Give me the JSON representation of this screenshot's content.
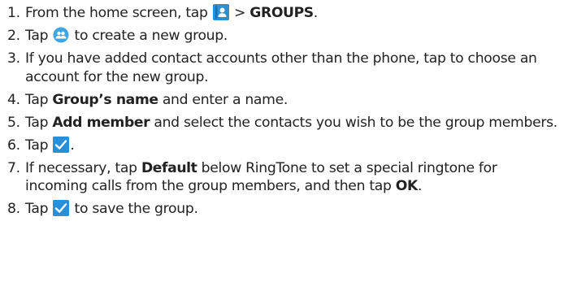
{
  "colors": {
    "text": "#222222",
    "icon_blue": "#2b8fd6",
    "icon_light_blue": "#3ea6e6"
  },
  "icons": {
    "contacts": "contacts-app-icon",
    "add_group": "add-group-icon",
    "check": "check-icon"
  },
  "steps": [
    {
      "num": "1.",
      "pre": "From the home screen, tap",
      "mid": ">",
      "bold": "GROUPS",
      "post": "."
    },
    {
      "num": "2.",
      "pre": "Tap",
      "post": "to create a new group."
    },
    {
      "num": "3.",
      "text": "If you have added contact accounts other than the phone, tap to choose an account for the new group."
    },
    {
      "num": "4.",
      "pre": "Tap",
      "bold": "Group’s name",
      "post": "and enter a name."
    },
    {
      "num": "5.",
      "pre": "Tap",
      "bold": "Add member",
      "post": "and select the contacts you wish to be the group members."
    },
    {
      "num": "6.",
      "pre": "Tap",
      "post": "."
    },
    {
      "num": "7.",
      "pre": "If necessary, tap",
      "bold": "Default",
      "post": "below RingTone to set a special ringtone for incoming calls from the group members, and then tap",
      "bold2": "OK",
      "post2": "."
    },
    {
      "num": "8.",
      "pre": "Tap",
      "post": "to save the group."
    }
  ]
}
